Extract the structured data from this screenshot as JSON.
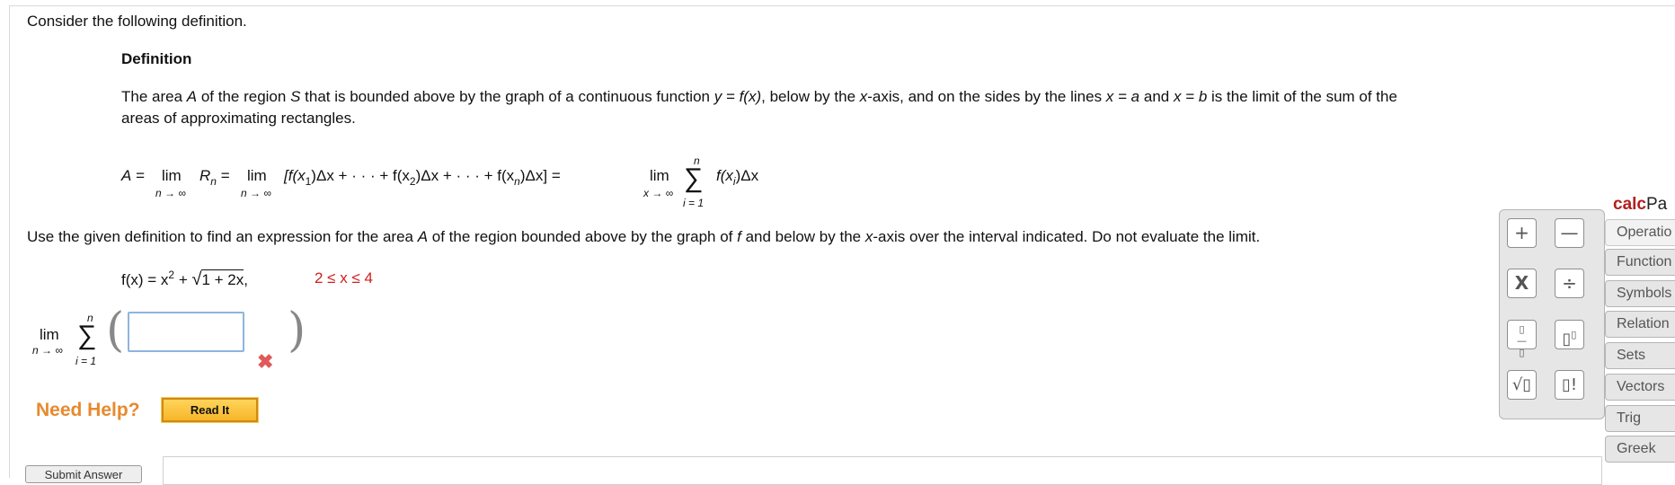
{
  "intro": "Consider the following definition.",
  "definition": {
    "heading": "Definition",
    "line1_a": "The area ",
    "A": "A",
    "line1_b": " of the region ",
    "S": "S",
    "line1_c": " that is bounded above by the graph of a continuous function ",
    "yfx": "y = f(x)",
    "line1_d": ", below by the ",
    "xaxis": "x",
    "line1_e": "-axis, and on the sides by the lines ",
    "xa": "x = a",
    "and": " and ",
    "xb": "x = b",
    "line1_f": " is the limit of the sum of the",
    "line2": "areas of approximating rectangles.",
    "formula": {
      "A_eq": "A = ",
      "lim1": "lim",
      "R": "R",
      "n_sub": "n",
      "eq1": " = ",
      "lim2": "lim",
      "bracket_open": "[f(x",
      "one": "1",
      "part1": ")Δx + · · · + f(x",
      "two": "2",
      "part2": ")Δx + · · · + f(x",
      "n": "n",
      "part3": ")Δx] = ",
      "lim3": "lim",
      "sum_term_a": "f(x",
      "i": "i",
      "sum_term_b": ")Δx",
      "n_to_inf": "n → ∞",
      "x_to_inf": "x → ∞",
      "sum_top": "n",
      "sum_bottom": "i = 1",
      "sigma": "∑"
    }
  },
  "task": {
    "a": "Use the given definition to find an expression for the area ",
    "A": "A",
    "b": " of the region bounded above by the graph of ",
    "f": "f",
    "c": " and below by the ",
    "x": "x",
    "d": "-axis over the interval indicated. Do not evaluate the limit."
  },
  "function": {
    "lhs": "f(x) = x",
    "exp": "2",
    "plus": " + ",
    "radical": "√",
    "radicand": "1 + 2x",
    "comma": ",",
    "interval_a": "2 ≤ x ≤ 4"
  },
  "answer": {
    "lim": "lim",
    "n_to_inf": "n → ∞",
    "sum_top": "n",
    "sum_bottom": "i = 1",
    "sigma": "∑",
    "input_value": "",
    "status_icon": "x-mark-icon",
    "status_color": "#e05a5a"
  },
  "help": {
    "need_help": "Need Help?",
    "read_it": "Read It"
  },
  "submit": "Submit Answer",
  "calcpad": {
    "title_a": "calc",
    "title_b": "Pa",
    "buttons": [
      "+",
      "—",
      "X",
      "÷",
      "▯/▯",
      "▯▯",
      "√▯",
      "▯!"
    ],
    "tabs": [
      "Operatio",
      "Function",
      "Symbols",
      "Relation",
      "Sets",
      "Vectors",
      "Trig",
      "Greek"
    ]
  },
  "colors": {
    "accent_orange": "#e68a2e",
    "error_red": "#cc1f1f",
    "calcpad_red": "#b21f1f"
  }
}
